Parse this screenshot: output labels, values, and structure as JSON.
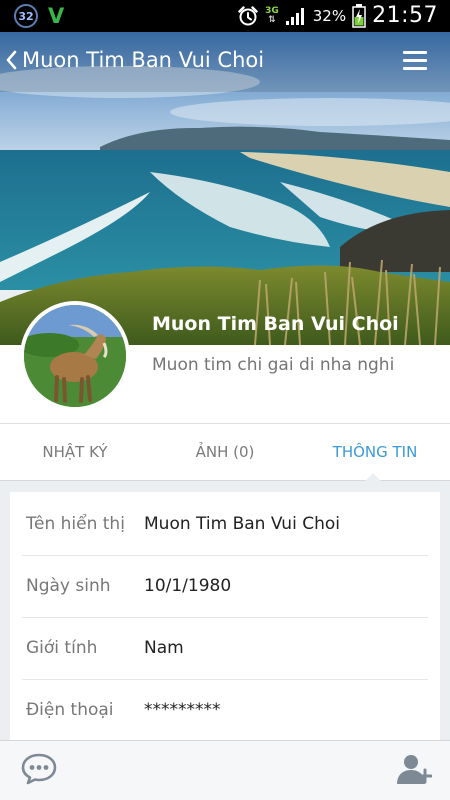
{
  "status_bar": {
    "notification_badge": "32",
    "app_logo": "V",
    "network_type": "3G",
    "battery_percent": "32%",
    "time": "21:57",
    "icons": [
      "alarm-icon",
      "signal-icon",
      "battery-icon"
    ]
  },
  "app_bar": {
    "title": "Muon Tim Ban Vui Choi",
    "back_icon": "chevron-left-icon",
    "menu_icon": "hamburger-menu-icon"
  },
  "profile": {
    "name": "Muon Tim Ban Vui Choi",
    "status": "Muon tim chi gai di nha nghi"
  },
  "tabs": [
    {
      "label": "NHẬT KÝ",
      "active": false
    },
    {
      "label": "ẢNH (0)",
      "active": false
    },
    {
      "label": "THÔNG TIN",
      "active": true
    }
  ],
  "info_rows": [
    {
      "label": "Tên hiển thị",
      "value": "Muon Tim Ban Vui Choi"
    },
    {
      "label": "Ngày sinh",
      "value": "10/1/1980"
    },
    {
      "label": "Giới tính",
      "value": "Nam"
    },
    {
      "label": "Điện thoại",
      "value": "*********"
    }
  ],
  "bottom_bar": {
    "left_icon": "chat-bubble-icon",
    "right_icon": "add-friend-icon"
  },
  "colors": {
    "accent": "#3a9ad9",
    "status_bar_bg": "#000000",
    "page_bg": "#eceff1"
  }
}
